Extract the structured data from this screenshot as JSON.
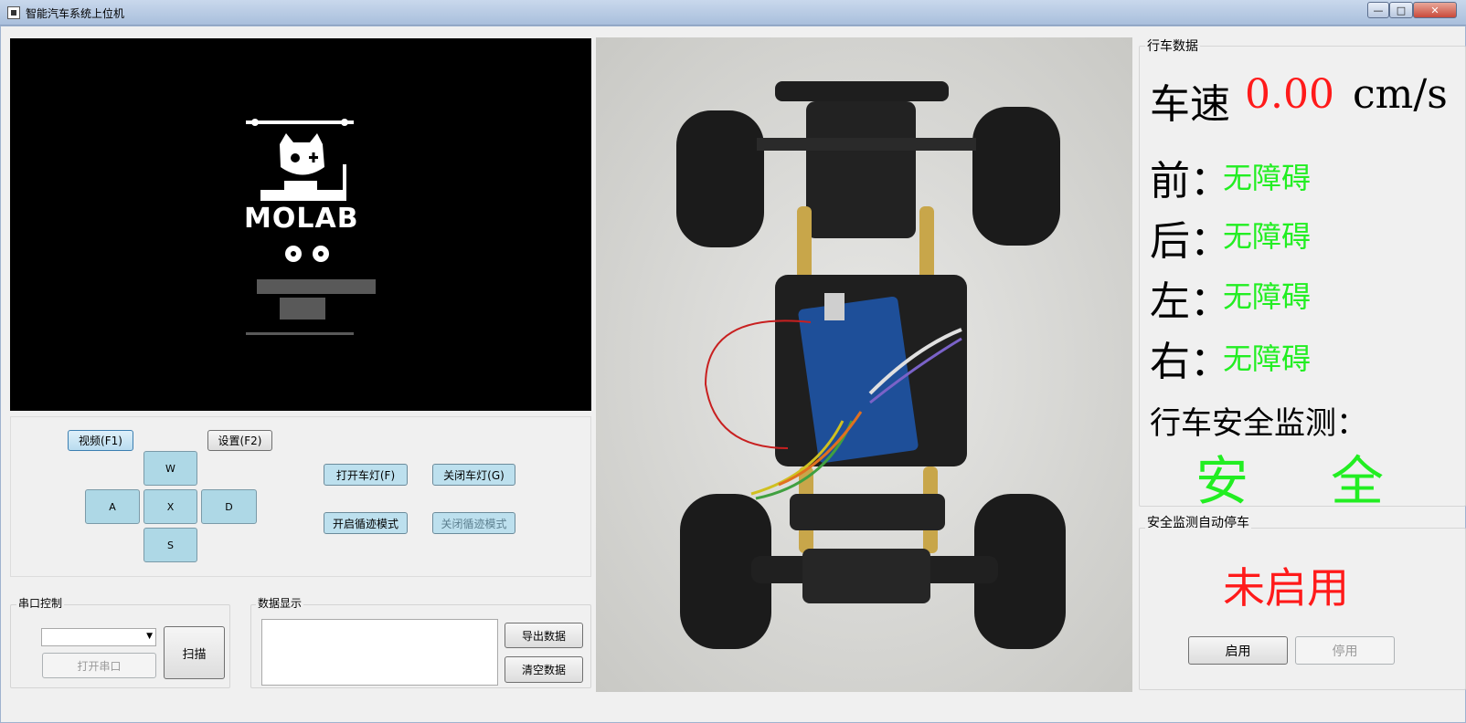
{
  "window": {
    "title": "智能汽车系统上位机",
    "minimize": "—",
    "maximize": "□",
    "close": "✕"
  },
  "video_panel": {
    "logo_text": "MOLAB"
  },
  "controls": {
    "video_button": "视频(F1)",
    "settings_button": "设置(F2)",
    "forward_button": "W",
    "left_button": "A",
    "stop_button": "X",
    "right_button": "D",
    "backward_button": "S",
    "lights_on_button": "打开车灯(F)",
    "lights_off_button": "关闭车灯(G)",
    "track_on_button": "开启循迹模式",
    "track_off_button": "关闭循迹模式"
  },
  "serial": {
    "group_label": "串口控制",
    "port_value": "",
    "open_button": "打开串口",
    "scan_button": "扫描"
  },
  "data_display": {
    "group_label": "数据显示",
    "text_value": "",
    "export_button": "导出数据",
    "clear_button": "清空数据"
  },
  "driving_data": {
    "group_label": "行车数据",
    "speed_label": "车速",
    "speed_value": "0.00",
    "speed_unit": "cm/s",
    "front_label": "前：",
    "front_status": "无障碍",
    "rear_label": "后：",
    "rear_status": "无障碍",
    "left_label": "左：",
    "left_status": "无障碍",
    "right_label": "右：",
    "right_status": "无障碍",
    "safety_label": "行车安全监测：",
    "safety_char1": "安",
    "safety_char2": "全"
  },
  "auto_stop": {
    "group_label": "安全监测自动停车",
    "status": "未启用",
    "enable_button": "启用",
    "disable_button": "停用"
  },
  "colors": {
    "ok_green": "#22ee22",
    "alert_red": "#ff1a1a"
  }
}
